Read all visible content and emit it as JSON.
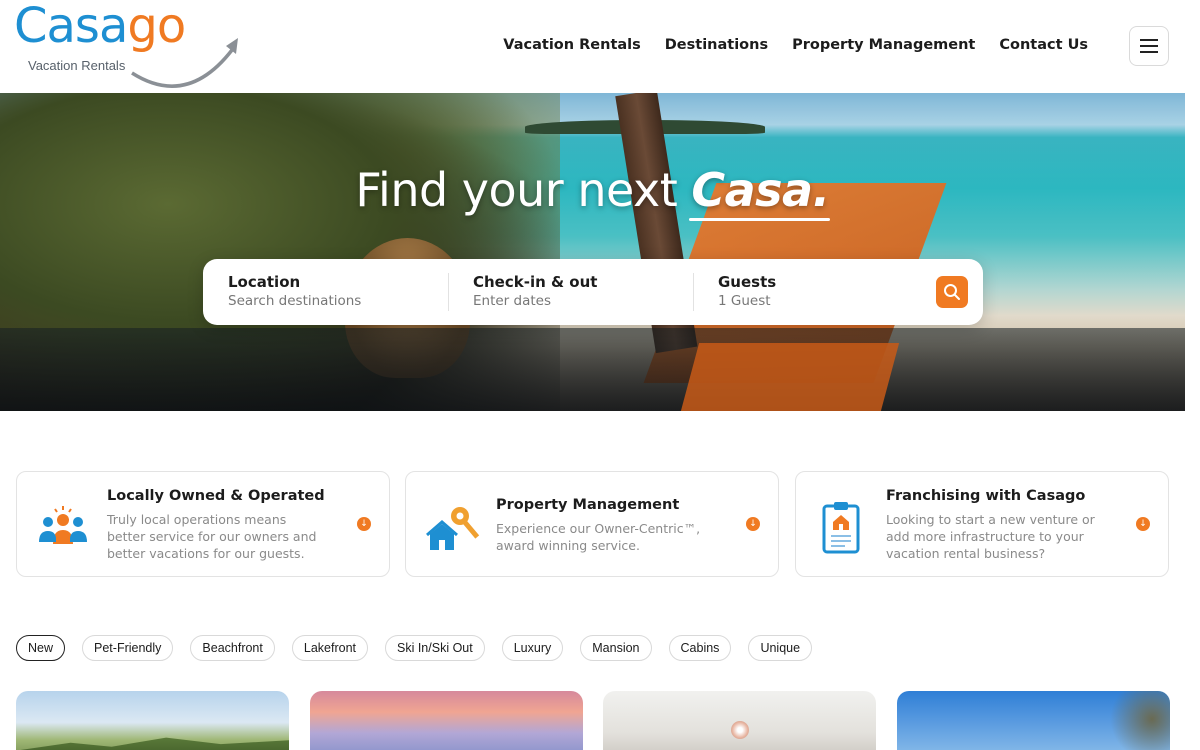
{
  "brand": {
    "logo_part1": "Casa",
    "logo_part2": "go",
    "logo_sub": "Vacation Rentals",
    "colors": {
      "blue": "#1e8fd2",
      "orange": "#f07a22"
    }
  },
  "nav": {
    "items": [
      "Vacation Rentals",
      "Destinations",
      "Property Management",
      "Contact Us"
    ],
    "menu_icon": "hamburger-menu-icon"
  },
  "hero": {
    "title_prefix": "Find your next ",
    "title_emphasis": "Casa."
  },
  "search": {
    "location_label": "Location",
    "location_placeholder": "Search destinations",
    "dates_label": "Check-in & out",
    "dates_placeholder": "Enter dates",
    "guests_label": "Guests",
    "guests_value": "1 Guest",
    "submit_icon": "search-icon"
  },
  "features": [
    {
      "title": "Locally Owned & Operated",
      "desc": "Truly local operations means better service for our owners and better vacations for our guests.",
      "icon": "people-group-icon"
    },
    {
      "title": "Property Management",
      "desc": "Experience our Owner-Centric™, award winning service.",
      "icon": "house-key-icon"
    },
    {
      "title": "Franchising with Casago",
      "desc": "Looking to start a new venture or add more infrastructure to your vacation rental business?",
      "icon": "clipboard-house-icon"
    }
  ],
  "filters": [
    "New",
    "Pet-Friendly",
    "Beachfront",
    "Lakefront",
    "Ski In/Ski Out",
    "Luxury",
    "Mansion",
    "Cabins",
    "Unique"
  ],
  "active_filter": "New"
}
